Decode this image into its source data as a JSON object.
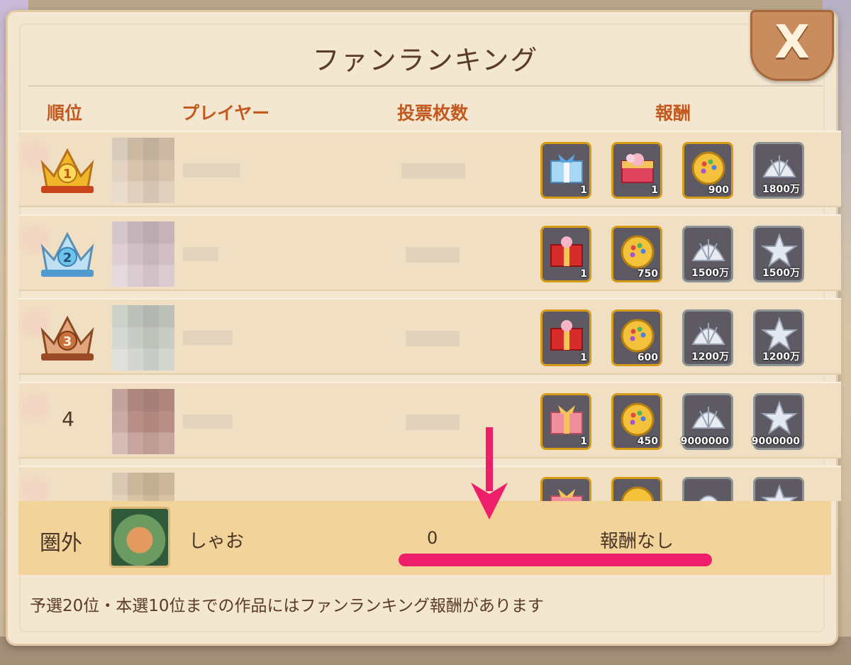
{
  "panel": {
    "title": "ファンランキング",
    "close_label": "X"
  },
  "columns": {
    "rank": "順位",
    "player": "プレイヤー",
    "votes": "投票枚数",
    "reward": "報酬"
  },
  "rows": [
    {
      "rank": "1",
      "rewards": [
        {
          "icon": "blue-gift-box-icon",
          "count": "1"
        },
        {
          "icon": "pink-flower-gift-box-icon",
          "count": "1"
        },
        {
          "icon": "gold-palette-coin-icon",
          "count": "900"
        },
        {
          "icon": "silver-shell-icon",
          "count": "1800万"
        }
      ]
    },
    {
      "rank": "2",
      "rewards": [
        {
          "icon": "red-gift-box-icon",
          "count": "1"
        },
        {
          "icon": "gold-palette-coin-icon",
          "count": "750"
        },
        {
          "icon": "silver-shell-icon",
          "count": "1500万"
        },
        {
          "icon": "silver-star-icon",
          "count": "1500万"
        }
      ]
    },
    {
      "rank": "3",
      "rewards": [
        {
          "icon": "red-gift-box-icon",
          "count": "1"
        },
        {
          "icon": "gold-palette-coin-icon",
          "count": "600"
        },
        {
          "icon": "silver-shell-icon",
          "count": "1200万"
        },
        {
          "icon": "silver-star-icon",
          "count": "1200万"
        }
      ]
    },
    {
      "rank": "4",
      "rewards": [
        {
          "icon": "pink-gift-box-icon",
          "count": "1"
        },
        {
          "icon": "gold-palette-coin-icon",
          "count": "450"
        },
        {
          "icon": "silver-shell-icon",
          "count": "9000000"
        },
        {
          "icon": "silver-star-icon",
          "count": "9000000"
        }
      ]
    }
  ],
  "me": {
    "rank_label": "圏外",
    "name": "しゃお",
    "votes": "0",
    "reward": "報酬なし"
  },
  "note": "予選20位・本選10位までの作品にはファンランキング報酬があります",
  "colors": {
    "highlight_pink": "#ee1f6a",
    "header_orange": "#c25a20",
    "gold_border": "#d79b18"
  }
}
